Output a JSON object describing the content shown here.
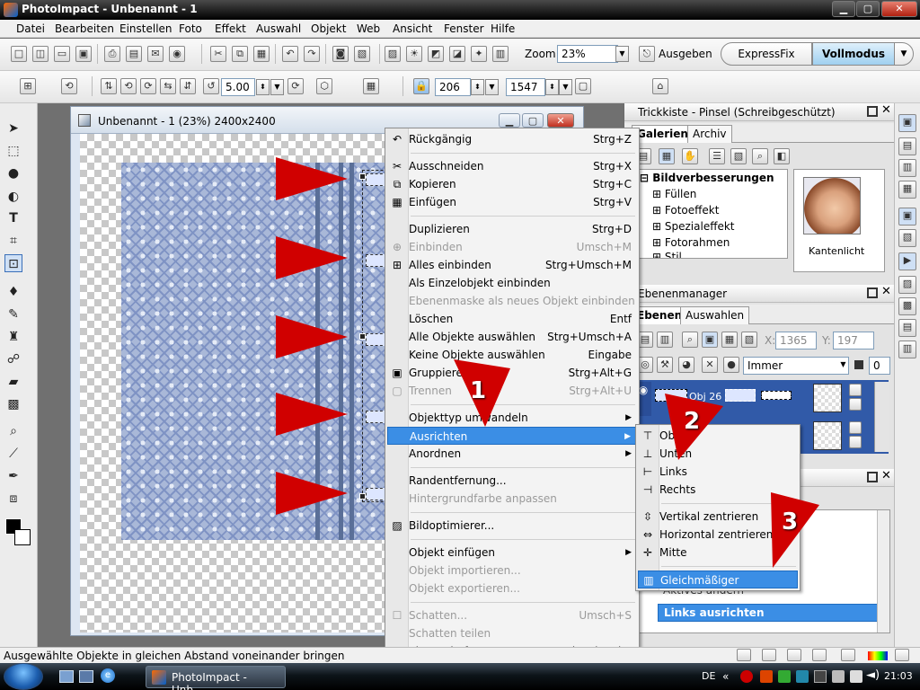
{
  "window": {
    "title": "PhotoImpact - Unbenannt - 1",
    "min": "▁",
    "max": "▢",
    "close": "✕"
  },
  "menubar": [
    "Datei",
    "Bearbeiten",
    "Einstellen",
    "Foto",
    "Effekt",
    "Auswahl",
    "Objekt",
    "Web",
    "Ansicht",
    "Fenster",
    "Hilfe"
  ],
  "toolbar": {
    "zoom_label": "Zoom",
    "zoom_value": "23%",
    "output_label": "Ausgeben",
    "expressfix": "ExpressFix",
    "fullmode": "Vollmodus"
  },
  "attrbar": {
    "rotate_value": "5.00",
    "width_value": "206",
    "height_value": "1547"
  },
  "document": {
    "title": "Unbenannt - 1 (23%) 2400x2400"
  },
  "context_menu": {
    "items": [
      {
        "label": "Rückgängig",
        "shortcut": "Strg+Z",
        "icon": "undo-icon",
        "enabled": true
      },
      {
        "label": "Ausschneiden",
        "shortcut": "Strg+X",
        "icon": "scissors-icon",
        "enabled": true
      },
      {
        "label": "Kopieren",
        "shortcut": "Strg+C",
        "icon": "copy-icon",
        "enabled": true
      },
      {
        "label": "Einfügen",
        "shortcut": "Strg+V",
        "icon": "paste-icon",
        "enabled": true
      },
      {
        "label": "Duplizieren",
        "shortcut": "Strg+D",
        "enabled": true
      },
      {
        "label": "Einbinden",
        "shortcut": "Umsch+M",
        "icon": "merge-icon",
        "enabled": false
      },
      {
        "label": "Alles einbinden",
        "shortcut": "Strg+Umsch+M",
        "icon": "merge-all-icon",
        "enabled": true
      },
      {
        "label": "Als Einzelobjekt einbinden",
        "shortcut": "",
        "enabled": true
      },
      {
        "label": "Ebenenmaske als neues Objekt einbinden",
        "shortcut": "",
        "enabled": false
      },
      {
        "label": "Löschen",
        "shortcut": "Entf",
        "enabled": true
      },
      {
        "label": "Alle Objekte auswählen",
        "shortcut": "Strg+Umsch+A",
        "enabled": true
      },
      {
        "label": "Keine Objekte auswählen",
        "shortcut": "Eingabe",
        "enabled": true
      },
      {
        "label": "Gruppieren",
        "shortcut": "Strg+Alt+G",
        "icon": "group-icon",
        "enabled": true
      },
      {
        "label": "Trennen",
        "shortcut": "Strg+Alt+U",
        "icon": "ungroup-icon",
        "enabled": false
      },
      {
        "label": "Objekttyp umwandeln",
        "shortcut": "",
        "submenu": true,
        "enabled": true
      },
      {
        "label": "Ausrichten",
        "shortcut": "",
        "submenu": true,
        "enabled": true,
        "highlighted": true
      },
      {
        "label": "Anordnen",
        "shortcut": "",
        "submenu": true,
        "enabled": true
      },
      {
        "label": "Randentfernung...",
        "shortcut": "",
        "enabled": true
      },
      {
        "label": "Hintergrundfarbe anpassen",
        "shortcut": "",
        "enabled": false
      },
      {
        "label": "Bildoptimierer...",
        "shortcut": "",
        "icon": "optimizer-icon",
        "enabled": true
      },
      {
        "label": "Objekt einfügen",
        "shortcut": "",
        "submenu": true,
        "enabled": true
      },
      {
        "label": "Objekt importieren...",
        "shortcut": "",
        "enabled": false
      },
      {
        "label": "Objekt exportieren...",
        "shortcut": "",
        "enabled": false
      },
      {
        "label": "Schatten...",
        "shortcut": "Umsch+S",
        "icon": "checkbox-icon",
        "enabled": false
      },
      {
        "label": "Schatten teilen",
        "shortcut": "",
        "enabled": false
      },
      {
        "label": "Eigenschaften...",
        "shortcut": "Strg+Umsch+Eingabe",
        "icon": "properties-icon",
        "enabled": true
      }
    ]
  },
  "submenu": {
    "items": [
      {
        "label": "Oben",
        "icon": "align-top-icon"
      },
      {
        "label": "Unten",
        "icon": "align-bottom-icon"
      },
      {
        "label": "Links",
        "icon": "align-left-icon"
      },
      {
        "label": "Rechts",
        "icon": "align-right-icon"
      },
      {
        "label": "Vertikal zentrieren",
        "icon": "center-vertical-icon"
      },
      {
        "label": "Horizontal zentrieren",
        "icon": "center-horizontal-icon"
      },
      {
        "label": "Mitte",
        "icon": "center-icon"
      },
      {
        "label": "Gleichmäßiger Abstand...",
        "icon": "equal-spacing-icon",
        "highlighted": true
      }
    ]
  },
  "callouts": [
    "1",
    "2",
    "3"
  ],
  "trickkiste": {
    "title": "Trickkiste - Pinsel (Schreibgeschützt)",
    "tabs": [
      "Galerien",
      "Archiv"
    ],
    "tree": [
      "Bildverbesserungen",
      "Füllen",
      "Fotoeffekt",
      "Spezialeffekt",
      "Fotorahmen",
      "Stil"
    ],
    "thumb_label": "Kantenlicht"
  },
  "ebenenmanager": {
    "title": "Ebenenmanager",
    "tabs": [
      "Ebenen",
      "Auswahlen"
    ],
    "x_label": "X:",
    "x_value": "1365",
    "y_label": "Y:",
    "y_value": "197",
    "mode": "Immer",
    "opacity": "0",
    "layer_name": "Obj 26"
  },
  "history": {
    "item1": "Aktives ändern",
    "item2": "Links ausrichten"
  },
  "statusbar": {
    "text": "Ausgewählte Objekte in gleichen Abstand voneinander bringen"
  },
  "taskbar": {
    "task": "PhotoImpact - Unb...",
    "lang": "DE",
    "clock": "21:03"
  }
}
